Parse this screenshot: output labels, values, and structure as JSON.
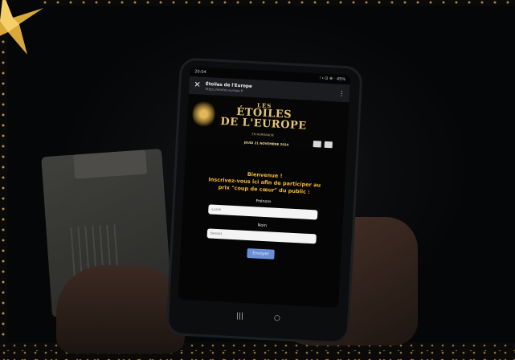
{
  "phone": {
    "status": {
      "time": "20:04",
      "icons": "⁝ ⬩ ⊡ ⊕ · 45%"
    },
    "browser": {
      "title": "Étoiles de l'Europe",
      "url": "https://etoiles-europe.fr"
    },
    "banner": {
      "line1": "LES",
      "line2": "ÉTOILES",
      "line3": "DE L'EUROPE",
      "subtitle": "EN NORMANDIE",
      "date": "JEUDI 21 NOVEMBRE 2024"
    },
    "form": {
      "welcome": "Bienvenue !",
      "intro1": "Inscrivez-vous ici afin de participer au",
      "intro2": "prix \"coup de cœur\" du public :",
      "firstname_label": "Prénom",
      "firstname_placeholder": "Lucie",
      "lastname_label": "Nom",
      "lastname_placeholder": "Benoit",
      "submit_label": "Envoyer"
    },
    "nav": {
      "recent": "|||",
      "home": "○"
    }
  },
  "colors": {
    "accent": "#f2b632",
    "gold": "#e6c674",
    "button": "#6b8fd6"
  }
}
